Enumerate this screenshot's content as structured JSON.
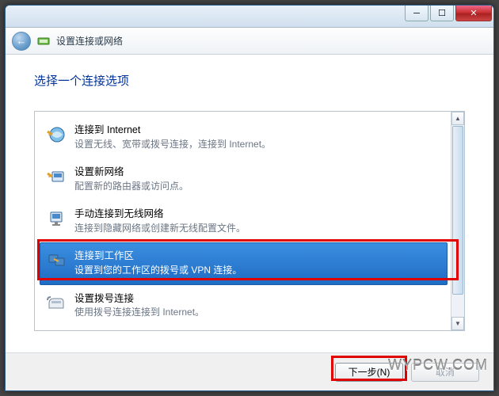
{
  "window": {
    "title": "设置连接或网络"
  },
  "heading": "选择一个连接选项",
  "options": [
    {
      "title": "连接到 Internet",
      "desc": "设置无线、宽带或拨号连接，连接到 Internet。"
    },
    {
      "title": "设置新网络",
      "desc": "配置新的路由器或访问点。"
    },
    {
      "title": "手动连接到无线网络",
      "desc": "连接到隐藏网络或创建新无线配置文件。"
    },
    {
      "title": "连接到工作区",
      "desc": "设置到您的工作区的拨号或 VPN 连接。"
    },
    {
      "title": "设置拨号连接",
      "desc": "使用拨号连接连接到 Internet。"
    }
  ],
  "selected_index": 3,
  "buttons": {
    "next": "下一步(N)",
    "cancel": "取消"
  },
  "watermark": "WYPCW.COM"
}
